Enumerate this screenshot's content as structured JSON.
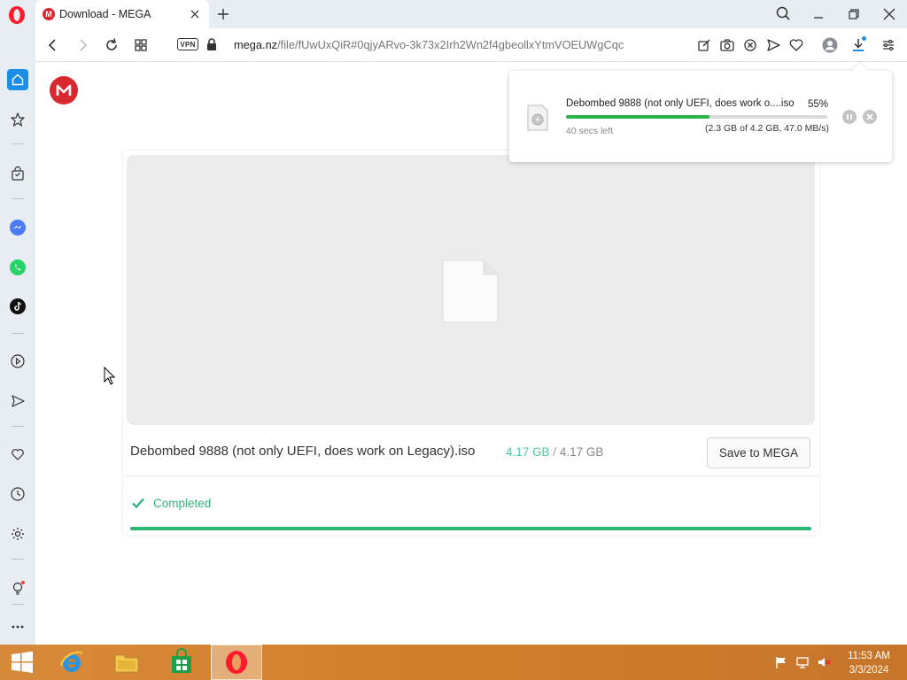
{
  "browser": {
    "tab": {
      "favicon_letter": "M",
      "title": "Download - MEGA"
    },
    "address": {
      "vpn_label": "VPN",
      "url_domain": "mega.nz",
      "url_path": "/file/fUwUxQiR#0qjyARvo-3k73x2Irh2Wn2f4gbeollxYtmVOEUWgCqc"
    }
  },
  "page": {
    "logo_letter": "M",
    "file": {
      "name": "Debombed 9888 (not only UEFI, does work on Legacy).iso",
      "downloaded": "4.17 GB",
      "separator": "/",
      "total": "4.17 GB"
    },
    "save_button_label": "Save to MEGA",
    "status_text": "Completed",
    "progress": 1.0
  },
  "download_popup": {
    "file_name": "Debombed 9888 (not only UEFI, does work o....iso",
    "percent_label": "55%",
    "progress": 0.55,
    "time_left": "40 secs left",
    "detail": "(2.3 GB of 4.2 GB, 47.0 MB/s)"
  },
  "taskbar": {
    "time": "11:53 AM",
    "date": "3/3/2024"
  },
  "colors": {
    "mega_red": "#d9272e",
    "complete_green": "#2bb673",
    "size_done_teal": "#4bc9a0",
    "opera_red": "#ff1b2d",
    "sidebar_bg": "#e8edf3",
    "taskbar_orange": "#d27f2c"
  }
}
